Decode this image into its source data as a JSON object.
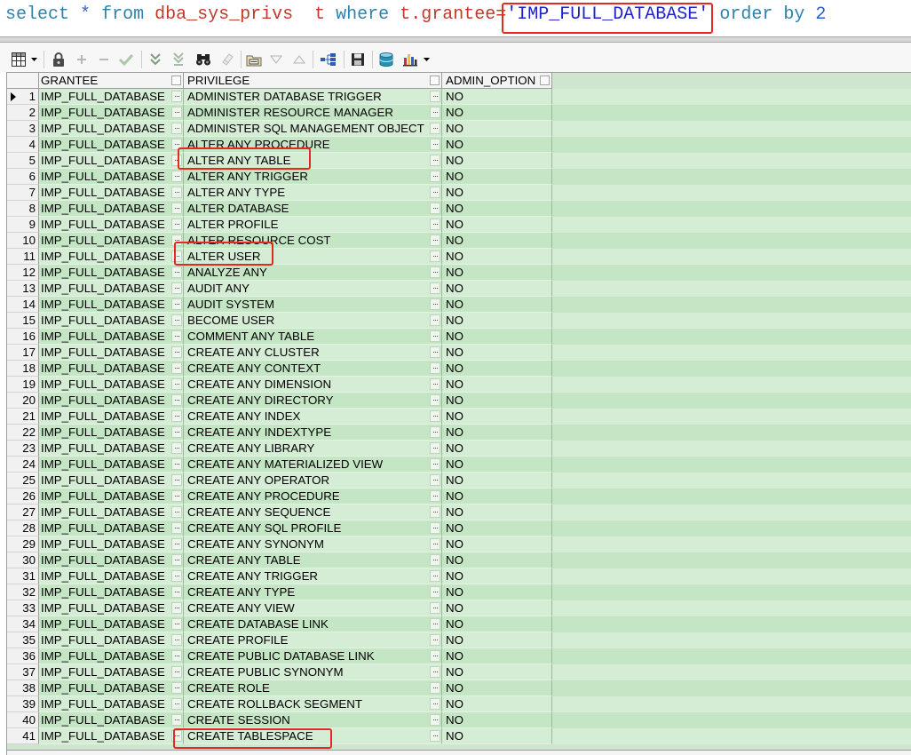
{
  "editor": {
    "tokens": [
      {
        "text": "select",
        "color": "#2e82ad"
      },
      {
        "text": "*",
        "color": "#3a62b4"
      },
      {
        "text": "from",
        "color": "#2e82ad"
      },
      {
        "text": "dba_sys_privs",
        "color": "#c0392b"
      },
      {
        "text": "t",
        "color": "#c0392b"
      },
      {
        "text": "where",
        "color": "#2e82ad"
      },
      {
        "text": "t.grantee",
        "color": "#c0392b"
      },
      {
        "text": "=",
        "color": "#c0392b"
      },
      {
        "text": "'IMP_FULL_DATABASE'",
        "color": "#1e22c8"
      },
      {
        "text": "order by",
        "color": "#2e82ad"
      },
      {
        "text": "2",
        "color": "#2c5fd0"
      }
    ]
  },
  "toolbar": {
    "icons": [
      "grid-icon",
      "dropdown-arrow-icon",
      "lock-icon",
      "plus-icon",
      "minus-icon",
      "checkmark-icon",
      "double-chevron-down-icon",
      "double-chevron-down-bar-icon",
      "binoculars-icon",
      "eraser-icon",
      "query-by-example-icon",
      "triangle-down-icon",
      "triangle-up-icon",
      "hierarchy-icon",
      "floppy-disk-icon",
      "database-export-icon",
      "bar-chart-icon",
      "dropdown-arrow-icon"
    ]
  },
  "colors": {
    "grid_background": "#cde6cd",
    "row_a": "#d4edd4",
    "row_b": "#c5e6c5",
    "highlight": "#e42a20"
  },
  "grid": {
    "columns": [
      {
        "label": "GRANTEE"
      },
      {
        "label": "PRIVILEGE"
      },
      {
        "label": "ADMIN_OPTION"
      }
    ],
    "cell_button_glyph": "···",
    "rows": [
      {
        "n": 1,
        "grantee": "IMP_FULL_DATABASE",
        "privilege": "ADMINISTER DATABASE TRIGGER",
        "admin_option": "NO"
      },
      {
        "n": 2,
        "grantee": "IMP_FULL_DATABASE",
        "privilege": "ADMINISTER RESOURCE MANAGER",
        "admin_option": "NO"
      },
      {
        "n": 3,
        "grantee": "IMP_FULL_DATABASE",
        "privilege": "ADMINISTER SQL MANAGEMENT OBJECT",
        "admin_option": "NO"
      },
      {
        "n": 4,
        "grantee": "IMP_FULL_DATABASE",
        "privilege": "ALTER ANY PROCEDURE",
        "admin_option": "NO"
      },
      {
        "n": 5,
        "grantee": "IMP_FULL_DATABASE",
        "privilege": "ALTER ANY TABLE",
        "admin_option": "NO"
      },
      {
        "n": 6,
        "grantee": "IMP_FULL_DATABASE",
        "privilege": "ALTER ANY TRIGGER",
        "admin_option": "NO"
      },
      {
        "n": 7,
        "grantee": "IMP_FULL_DATABASE",
        "privilege": "ALTER ANY TYPE",
        "admin_option": "NO"
      },
      {
        "n": 8,
        "grantee": "IMP_FULL_DATABASE",
        "privilege": "ALTER DATABASE",
        "admin_option": "NO"
      },
      {
        "n": 9,
        "grantee": "IMP_FULL_DATABASE",
        "privilege": "ALTER PROFILE",
        "admin_option": "NO"
      },
      {
        "n": 10,
        "grantee": "IMP_FULL_DATABASE",
        "privilege": "ALTER RESOURCE COST",
        "admin_option": "NO"
      },
      {
        "n": 11,
        "grantee": "IMP_FULL_DATABASE",
        "privilege": "ALTER USER",
        "admin_option": "NO"
      },
      {
        "n": 12,
        "grantee": "IMP_FULL_DATABASE",
        "privilege": "ANALYZE ANY",
        "admin_option": "NO"
      },
      {
        "n": 13,
        "grantee": "IMP_FULL_DATABASE",
        "privilege": "AUDIT ANY",
        "admin_option": "NO"
      },
      {
        "n": 14,
        "grantee": "IMP_FULL_DATABASE",
        "privilege": "AUDIT SYSTEM",
        "admin_option": "NO"
      },
      {
        "n": 15,
        "grantee": "IMP_FULL_DATABASE",
        "privilege": "BECOME USER",
        "admin_option": "NO"
      },
      {
        "n": 16,
        "grantee": "IMP_FULL_DATABASE",
        "privilege": "COMMENT ANY TABLE",
        "admin_option": "NO"
      },
      {
        "n": 17,
        "grantee": "IMP_FULL_DATABASE",
        "privilege": "CREATE ANY CLUSTER",
        "admin_option": "NO"
      },
      {
        "n": 18,
        "grantee": "IMP_FULL_DATABASE",
        "privilege": "CREATE ANY CONTEXT",
        "admin_option": "NO"
      },
      {
        "n": 19,
        "grantee": "IMP_FULL_DATABASE",
        "privilege": "CREATE ANY DIMENSION",
        "admin_option": "NO"
      },
      {
        "n": 20,
        "grantee": "IMP_FULL_DATABASE",
        "privilege": "CREATE ANY DIRECTORY",
        "admin_option": "NO"
      },
      {
        "n": 21,
        "grantee": "IMP_FULL_DATABASE",
        "privilege": "CREATE ANY INDEX",
        "admin_option": "NO"
      },
      {
        "n": 22,
        "grantee": "IMP_FULL_DATABASE",
        "privilege": "CREATE ANY INDEXTYPE",
        "admin_option": "NO"
      },
      {
        "n": 23,
        "grantee": "IMP_FULL_DATABASE",
        "privilege": "CREATE ANY LIBRARY",
        "admin_option": "NO"
      },
      {
        "n": 24,
        "grantee": "IMP_FULL_DATABASE",
        "privilege": "CREATE ANY MATERIALIZED VIEW",
        "admin_option": "NO"
      },
      {
        "n": 25,
        "grantee": "IMP_FULL_DATABASE",
        "privilege": "CREATE ANY OPERATOR",
        "admin_option": "NO"
      },
      {
        "n": 26,
        "grantee": "IMP_FULL_DATABASE",
        "privilege": "CREATE ANY PROCEDURE",
        "admin_option": "NO"
      },
      {
        "n": 27,
        "grantee": "IMP_FULL_DATABASE",
        "privilege": "CREATE ANY SEQUENCE",
        "admin_option": "NO"
      },
      {
        "n": 28,
        "grantee": "IMP_FULL_DATABASE",
        "privilege": "CREATE ANY SQL PROFILE",
        "admin_option": "NO"
      },
      {
        "n": 29,
        "grantee": "IMP_FULL_DATABASE",
        "privilege": "CREATE ANY SYNONYM",
        "admin_option": "NO"
      },
      {
        "n": 30,
        "grantee": "IMP_FULL_DATABASE",
        "privilege": "CREATE ANY TABLE",
        "admin_option": "NO"
      },
      {
        "n": 31,
        "grantee": "IMP_FULL_DATABASE",
        "privilege": "CREATE ANY TRIGGER",
        "admin_option": "NO"
      },
      {
        "n": 32,
        "grantee": "IMP_FULL_DATABASE",
        "privilege": "CREATE ANY TYPE",
        "admin_option": "NO"
      },
      {
        "n": 33,
        "grantee": "IMP_FULL_DATABASE",
        "privilege": "CREATE ANY VIEW",
        "admin_option": "NO"
      },
      {
        "n": 34,
        "grantee": "IMP_FULL_DATABASE",
        "privilege": "CREATE DATABASE LINK",
        "admin_option": "NO"
      },
      {
        "n": 35,
        "grantee": "IMP_FULL_DATABASE",
        "privilege": "CREATE PROFILE",
        "admin_option": "NO"
      },
      {
        "n": 36,
        "grantee": "IMP_FULL_DATABASE",
        "privilege": "CREATE PUBLIC DATABASE LINK",
        "admin_option": "NO"
      },
      {
        "n": 37,
        "grantee": "IMP_FULL_DATABASE",
        "privilege": "CREATE PUBLIC SYNONYM",
        "admin_option": "NO"
      },
      {
        "n": 38,
        "grantee": "IMP_FULL_DATABASE",
        "privilege": "CREATE ROLE",
        "admin_option": "NO"
      },
      {
        "n": 39,
        "grantee": "IMP_FULL_DATABASE",
        "privilege": "CREATE ROLLBACK SEGMENT",
        "admin_option": "NO"
      },
      {
        "n": 40,
        "grantee": "IMP_FULL_DATABASE",
        "privilege": "CREATE SESSION",
        "admin_option": "NO"
      },
      {
        "n": 41,
        "grantee": "IMP_FULL_DATABASE",
        "privilege": "CREATE TABLESPACE",
        "admin_option": "NO"
      }
    ]
  }
}
